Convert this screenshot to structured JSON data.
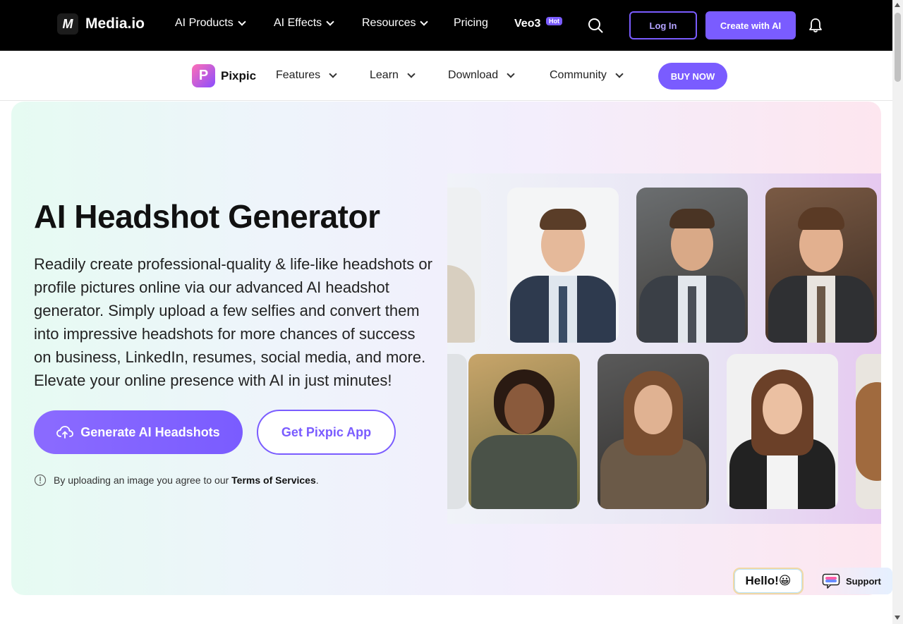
{
  "topnav": {
    "brand": "Media.io",
    "brand_mark": "M",
    "items": [
      {
        "label": "AI Products",
        "has_dropdown": true
      },
      {
        "label": "AI Effects",
        "has_dropdown": true
      },
      {
        "label": "Resources",
        "has_dropdown": true
      },
      {
        "label": "Pricing",
        "has_dropdown": false
      }
    ],
    "veo_label": "Veo3",
    "hot_badge": "Hot",
    "login_label": "Log In",
    "create_label": "Create with AI",
    "accent_color": "#7a5cff"
  },
  "subnav": {
    "brand": "Pixpic",
    "brand_mark": "P",
    "items": [
      {
        "label": "Features"
      },
      {
        "label": "Learn"
      },
      {
        "label": "Download"
      },
      {
        "label": "Community"
      }
    ],
    "buy_label": "BUY NOW"
  },
  "hero": {
    "title": "AI Headshot Generator",
    "description": "Readily create professional-quality & life-like headshots or profile pictures online via our advanced AI headshot generator. Simply upload a few selfies and convert them into impressive headshots for more chances of success on business, LinkedIn, resumes, social media, and more. Elevate your online presence with AI in just minutes!",
    "primary_button": "Generate AI Headshots",
    "secondary_button": "Get Pixpic App",
    "terms_prefix": "By uploading an image you agree to our ",
    "terms_link": "Terms of Services",
    "terms_suffix": "."
  },
  "floating": {
    "hello_label": "Hello!😀",
    "support_label": "Support"
  },
  "icons": {
    "search": "search-icon",
    "bell": "bell-icon",
    "upload": "cloud-upload-icon",
    "info": "info-icon",
    "chat": "chat-icon"
  }
}
